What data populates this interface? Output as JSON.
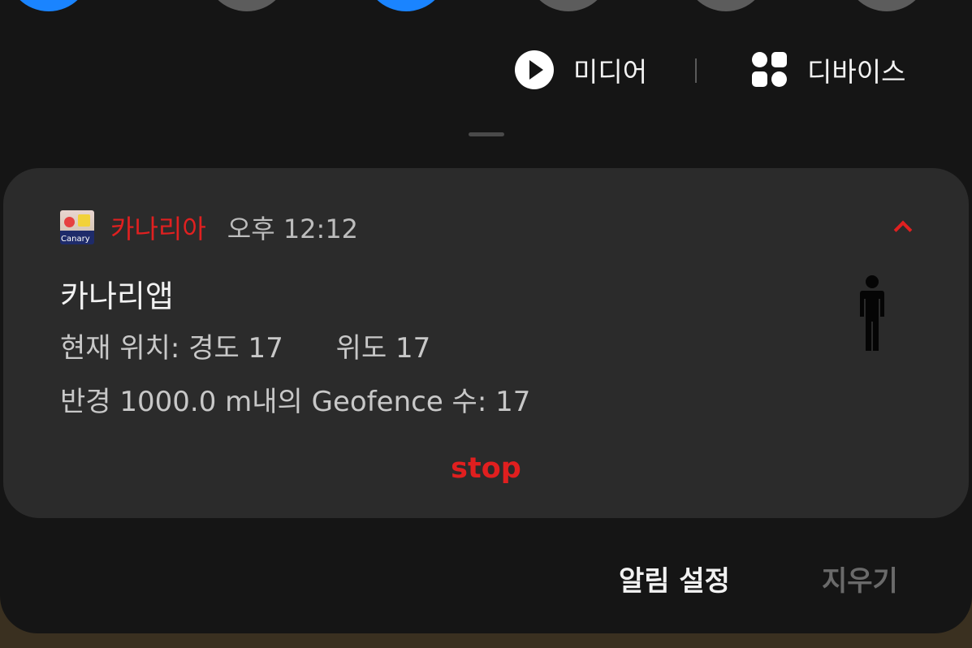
{
  "quick_settings": {
    "buttons": [
      {
        "name": "quick-toggle-1",
        "state": "on"
      },
      {
        "name": "quick-toggle-2",
        "state": "off"
      },
      {
        "name": "quick-toggle-3",
        "state": "on"
      },
      {
        "name": "quick-toggle-4",
        "state": "off"
      },
      {
        "name": "quick-toggle-5",
        "state": "off"
      },
      {
        "name": "quick-toggle-6",
        "state": "off"
      }
    ],
    "media_label": "미디어",
    "devices_label": "디바이스"
  },
  "notification": {
    "app_name": "카나리아",
    "app_icon_text": "Canary",
    "time": "오후 12:12",
    "title": "카나리앱",
    "location_line": "현재 위치: 경도 17      위도 17",
    "geofence_line": "반경 1000.0 m내의 Geofence 수: 17",
    "action_label": "stop",
    "large_icon": "person-standing-icon"
  },
  "footer": {
    "settings_label": "알림 설정",
    "clear_label": "지우기"
  },
  "colors": {
    "accent_red": "#e02020",
    "toggle_on": "#1a84ff",
    "toggle_off": "#5c5c5c",
    "card_bg": "#2b2b2b",
    "panel_bg": "#151515"
  }
}
